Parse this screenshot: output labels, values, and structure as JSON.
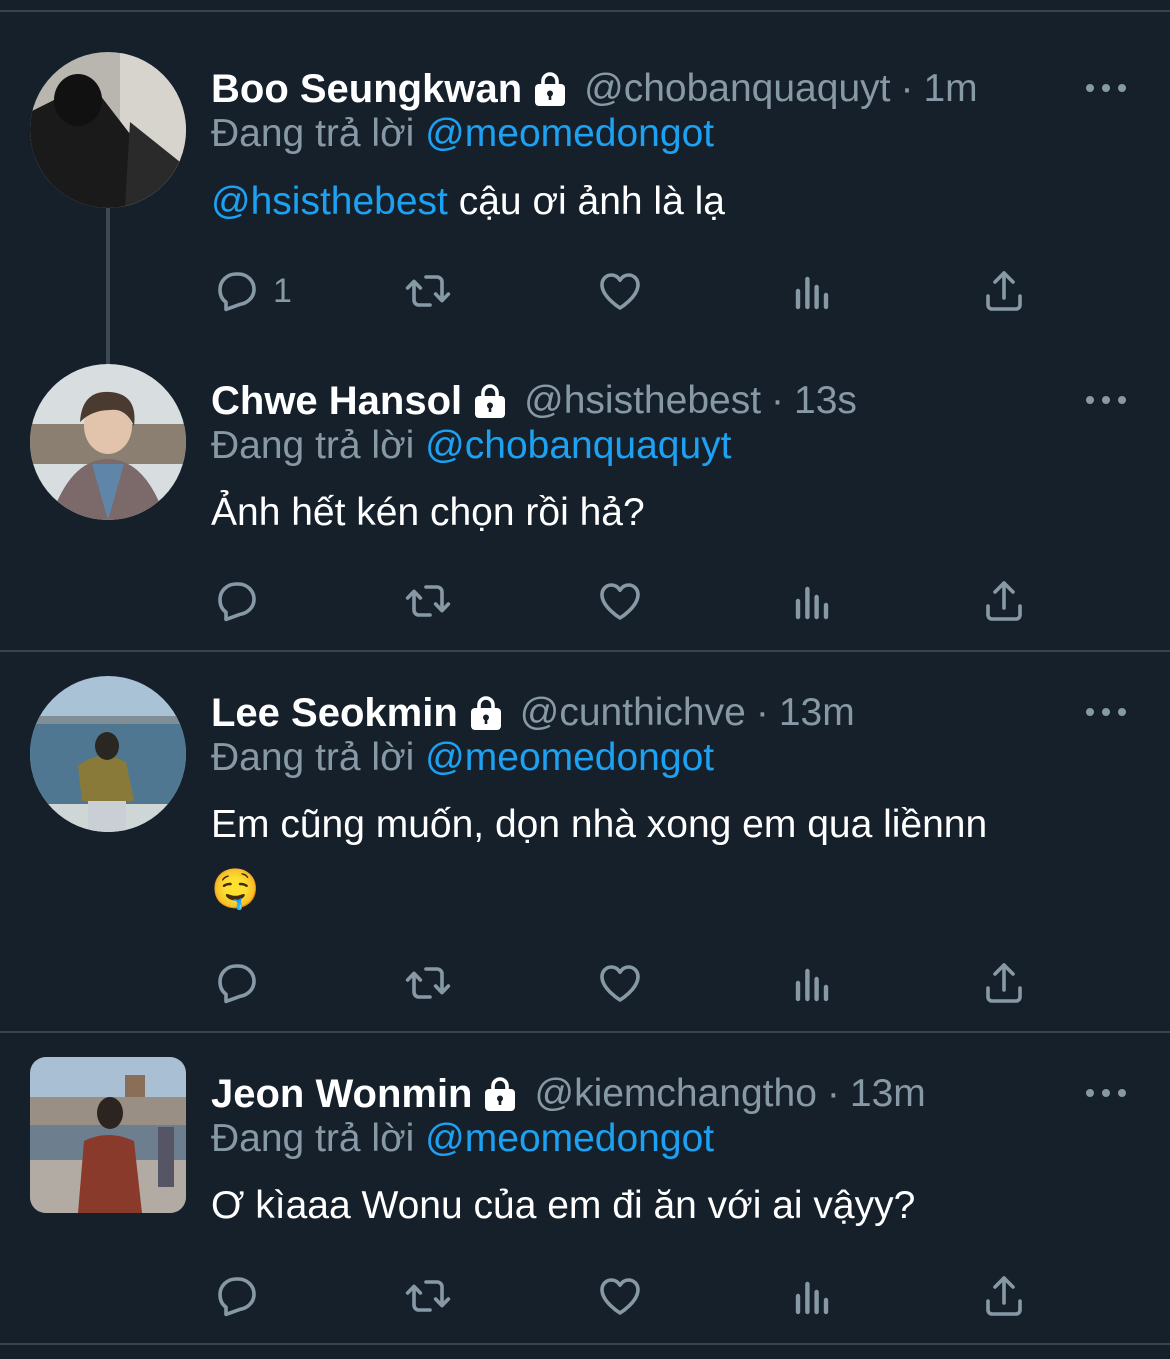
{
  "tweets": [
    {
      "name": "Boo Seungkwan",
      "handle": "@chobanquaquyt",
      "time": "1m",
      "replying_prefix": "Đang trả lời",
      "replying_to": "@meomedongot",
      "text_mention": "@hsisthebest",
      "text": " cậu ơi ảnh là lạ",
      "reply_count": "1"
    },
    {
      "name": "Chwe Hansol",
      "handle": "@hsisthebest",
      "time": "13s",
      "replying_prefix": "Đang trả lời",
      "replying_to": "@chobanquaquyt",
      "text": "Ảnh hết kén chọn rồi hả?",
      "reply_count": ""
    },
    {
      "name": "Lee Seokmin",
      "handle": "@cunthichve",
      "time": "13m",
      "replying_prefix": "Đang trả lời",
      "replying_to": "@meomedongot",
      "text": "Em cũng muốn, dọn nhà xong em qua liềnnn",
      "emoji": "🤤",
      "reply_count": ""
    },
    {
      "name": "Jeon Wonmin",
      "handle": "@kiemchangtho",
      "time": "13m",
      "replying_prefix": "Đang trả lời",
      "replying_to": "@meomedongot",
      "text": "Ơ kìaaa Wonu của em đi ăn với ai vậyy?",
      "reply_count": ""
    }
  ],
  "icons": {
    "reply": "reply-icon",
    "retweet": "retweet-icon",
    "like": "heart-icon",
    "analytics": "analytics-icon",
    "share": "share-icon",
    "lock": "lock-icon",
    "more": "more-icon"
  },
  "colors": {
    "background": "#15202b",
    "secondary_text": "#8899a6",
    "mention": "#1da1f2",
    "divider": "#38444d"
  }
}
